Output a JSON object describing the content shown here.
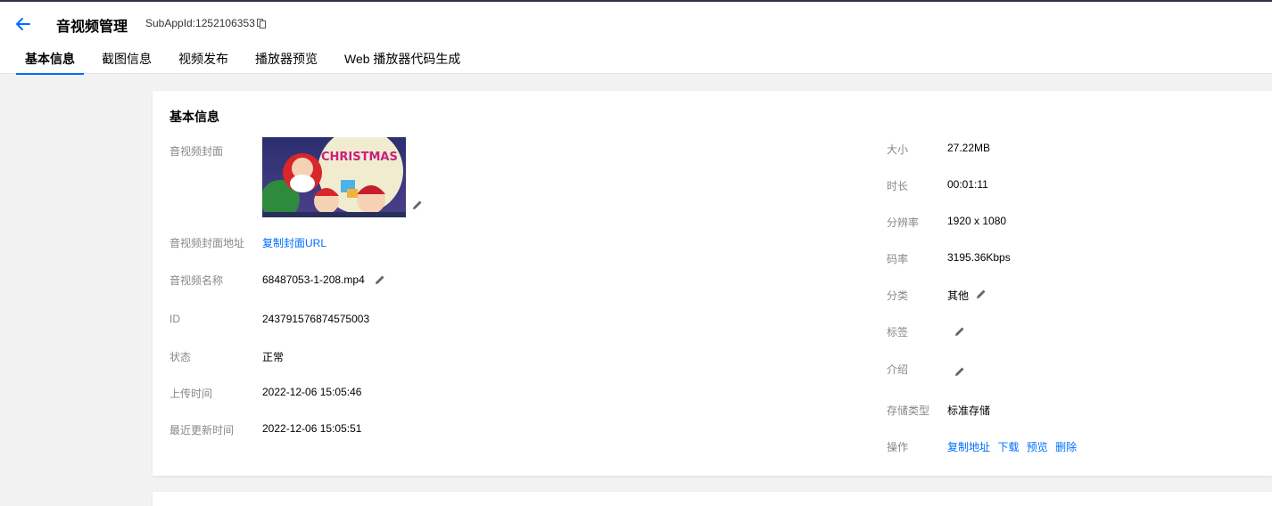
{
  "header": {
    "title": "音视频管理",
    "subapp_label": "SubAppId: ",
    "subapp_id": "1252106353"
  },
  "tabs": [
    {
      "label": "基本信息",
      "active": true
    },
    {
      "label": "截图信息"
    },
    {
      "label": "视频发布"
    },
    {
      "label": "播放器预览"
    },
    {
      "label": "Web 播放器代码生成"
    }
  ],
  "card": {
    "title": "基本信息",
    "left": {
      "cover_label": "音视频封面",
      "cover_image_text": "CHRISTMAS",
      "cover_url_label": "音视频封面地址",
      "cover_url_link": "复制封面URL",
      "name_label": "音视频名称",
      "name_value": "68487053-1-208.mp4",
      "id_label": "ID",
      "id_value": "243791576874575003",
      "status_label": "状态",
      "status_value": "正常",
      "upload_label": "上传时间",
      "upload_value": "2022-12-06 15:05:46",
      "updated_label": "最近更新时间",
      "updated_value": "2022-12-06 15:05:51"
    },
    "right": {
      "size_label": "大小",
      "size_value": "27.22MB",
      "duration_label": "时长",
      "duration_value": "00:01:11",
      "resolution_label": "分辨率",
      "resolution_value": "1920 x 1080",
      "bitrate_label": "码率",
      "bitrate_value": "3195.36Kbps",
      "category_label": "分类",
      "category_value": "其他",
      "tags_label": "标签",
      "intro_label": "介绍",
      "storage_label": "存储类型",
      "storage_value": "标准存储",
      "ops_label": "操作",
      "ops": [
        "复制地址",
        "下载",
        "预览",
        "删除"
      ]
    }
  },
  "colors": {
    "accent": "#006eff",
    "topline": "#2c3242",
    "background": "#f2f2f2"
  }
}
